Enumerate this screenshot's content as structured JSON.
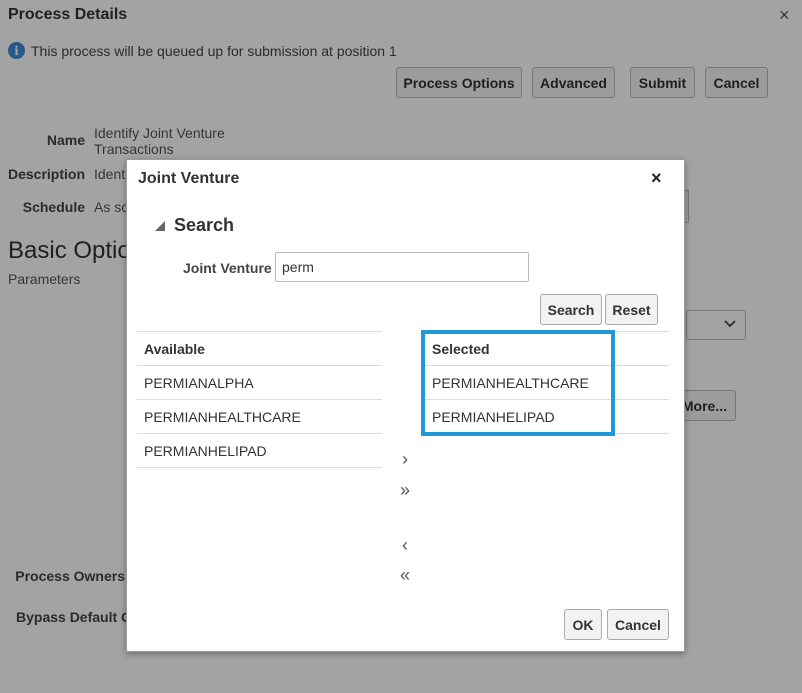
{
  "background": {
    "title": "Process Details",
    "close_icon": "×",
    "info_message": "This process will be queued up for submission at position 1",
    "buttons": {
      "process_options": "Process Options",
      "advanced": "Advanced",
      "submit": "Submit",
      "cancel": "Cancel"
    },
    "fields": {
      "name_label": "Name",
      "name_value_line1": "Identify Joint Venture",
      "name_value_line2": "Transactions",
      "description_label": "Description",
      "description_value": "Ident",
      "schedule_label": "Schedule",
      "schedule_value": "As sc"
    },
    "section_heading": "Basic Optio",
    "section_sub": "Parameters",
    "more_button": "More...",
    "process_owners_label": "Process Owners",
    "bypass_label": "Bypass Default O"
  },
  "modal": {
    "title": "Joint Venture",
    "close_icon": "×",
    "search_header": "Search",
    "jv_label": "Joint Venture",
    "jv_input_value": "perm",
    "search_button": "Search",
    "reset_button": "Reset",
    "available": {
      "header": "Available",
      "items": [
        "PERMIANALPHA",
        "PERMIANHEALTHCARE",
        "PERMIANHELIPAD"
      ]
    },
    "selected": {
      "header": "Selected",
      "items": [
        "PERMIANHEALTHCARE",
        "PERMIANHELIPAD"
      ]
    },
    "shuttle": {
      "move": "›",
      "move_all": "»",
      "remove": "‹",
      "remove_all": "«"
    },
    "ok_button": "OK",
    "cancel_button": "Cancel"
  },
  "colors": {
    "highlight": "#1f9ad6",
    "info_icon": "#3b8ad9"
  }
}
